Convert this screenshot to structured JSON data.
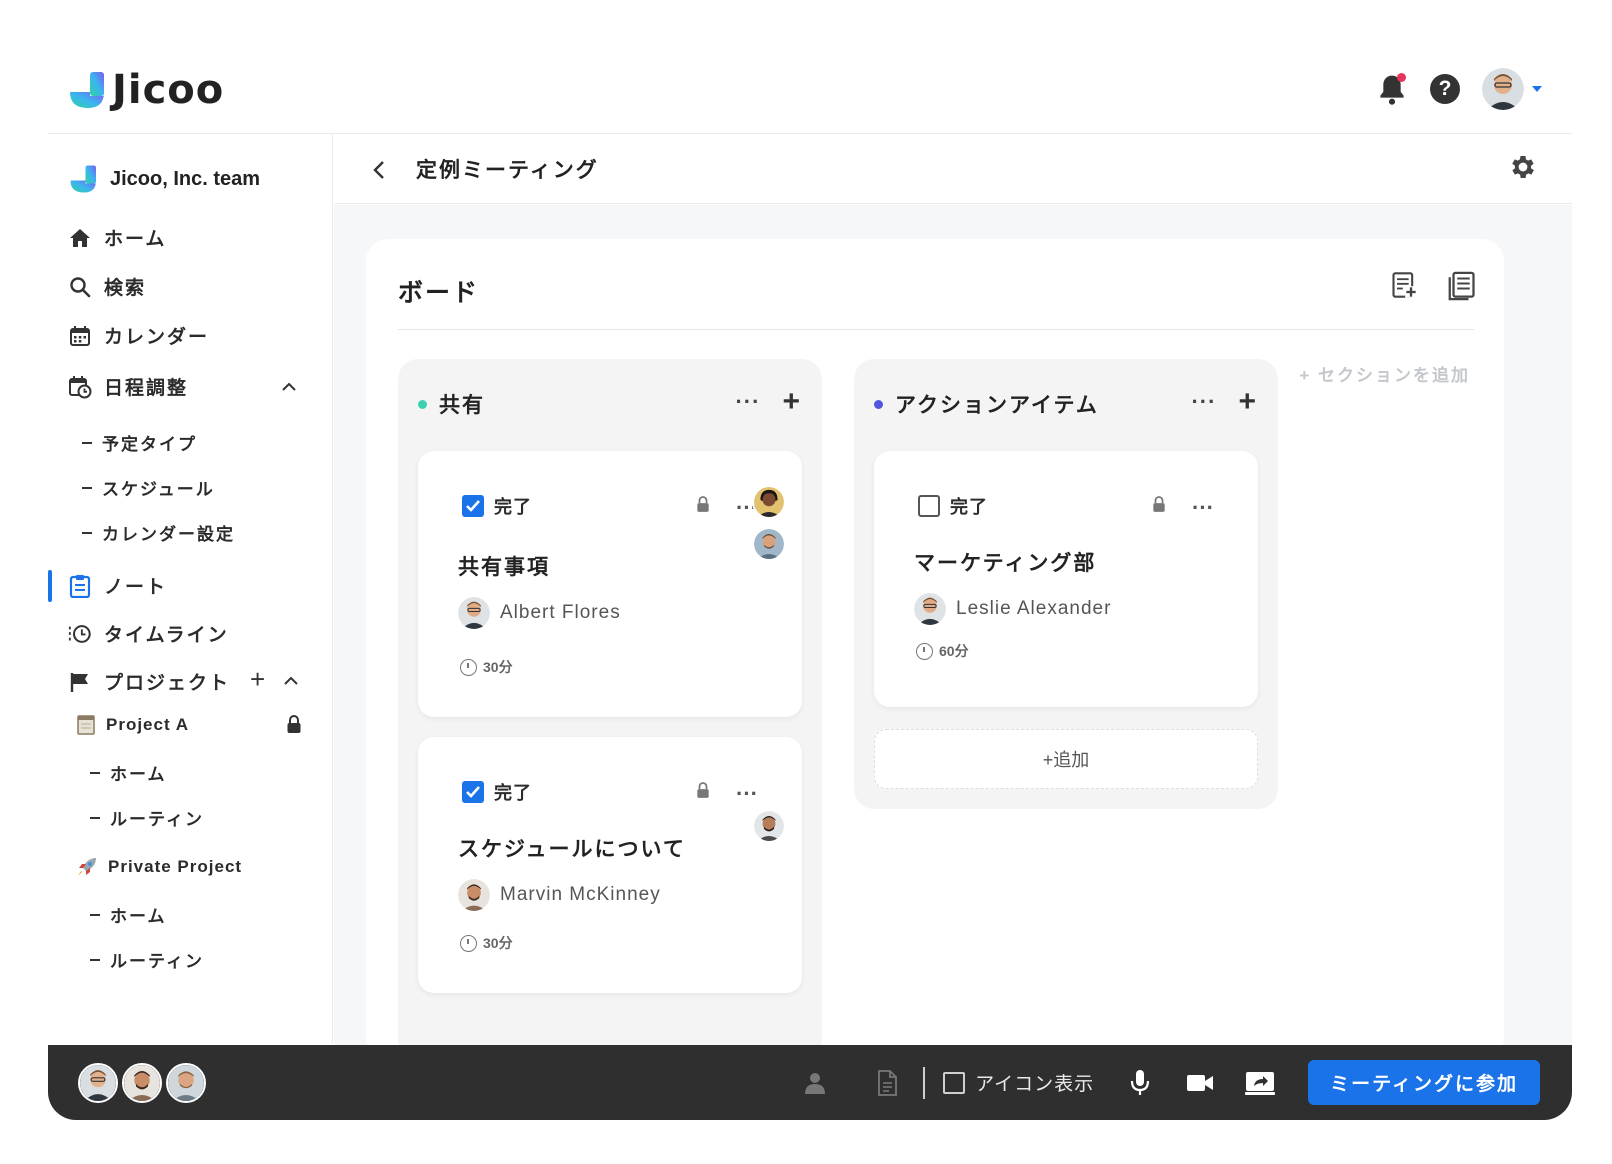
{
  "brand": {
    "name": "Jicoo"
  },
  "header": {
    "notifications_icon": "bell-icon",
    "help_icon": "help-icon"
  },
  "sidebar": {
    "team_name": "Jicoo, Inc. team",
    "items": [
      {
        "label": "ホーム",
        "icon": "home-icon"
      },
      {
        "label": "検索",
        "icon": "search-icon"
      },
      {
        "label": "カレンダー",
        "icon": "calendar-icon"
      },
      {
        "label": "日程調整",
        "icon": "calendar-clock-icon"
      },
      {
        "label": "ノート",
        "icon": "clipboard-icon"
      },
      {
        "label": "タイムライン",
        "icon": "history-icon"
      },
      {
        "label": "プロジェクト",
        "icon": "flag-icon"
      }
    ],
    "schedule_sub": [
      "予定タイプ",
      "スケジュール",
      "カレンダー設定"
    ],
    "projects": [
      {
        "name": "Project A",
        "icon": "notebook-icon",
        "sub": [
          "ホーム",
          "ルーティン"
        ]
      },
      {
        "name": "Private Project",
        "icon": "rocket-icon",
        "sub": [
          "ホーム",
          "ルーティン"
        ]
      }
    ],
    "active": "ノート"
  },
  "topbar": {
    "title": "定例ミーティング"
  },
  "board": {
    "title": "ボード",
    "add_section_label": "+ セクションを追加",
    "columns": [
      {
        "title": "共有",
        "dot_color": "#3ad0b0",
        "cards": [
          {
            "status": "完了",
            "checked": true,
            "title": "共有事項",
            "person": "Albert Flores",
            "duration": "30分"
          },
          {
            "status": "完了",
            "checked": true,
            "title": "スケジュールについて",
            "person": "Marvin McKinney",
            "duration": "30分"
          }
        ]
      },
      {
        "title": "アクションアイテム",
        "dot_color": "#5056e0",
        "cards": [
          {
            "status": "完了",
            "checked": false,
            "title": "マーケティング部",
            "person": "Leslie Alexander",
            "duration": "60分"
          }
        ],
        "add_label": "+追加"
      }
    ]
  },
  "bottombar": {
    "icon_toggle_label": "アイコン表示",
    "join_label": "ミーティングに参加",
    "accent": "#1a73e8"
  }
}
